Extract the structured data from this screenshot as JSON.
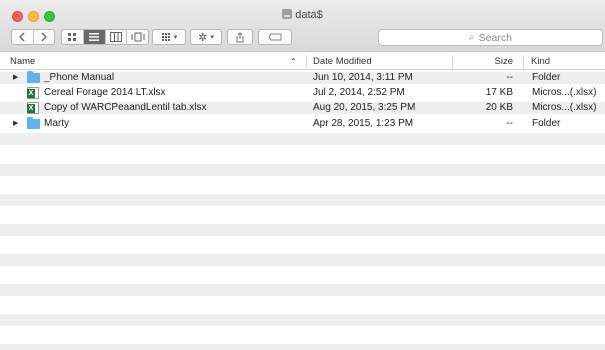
{
  "window": {
    "title": "data$"
  },
  "toolbar": {
    "back_icon": "chevron-left-icon",
    "forward_icon": "chevron-right-icon",
    "views": [
      "icon-view-icon",
      "list-view-icon",
      "column-view-icon",
      "cover-flow-icon"
    ],
    "arrange_icon": "grid-arrange-icon",
    "action_icon": "gear-icon",
    "share_icon": "share-icon",
    "tag_icon": "tag-icon"
  },
  "search": {
    "placeholder": "Search"
  },
  "columns": {
    "name": "Name",
    "date": "Date Modified",
    "size": "Size",
    "kind": "Kind"
  },
  "files": [
    {
      "name": "_Phone Manual",
      "date": "Jun 10, 2014, 3:11 PM",
      "size": "--",
      "kind": "Folder",
      "type": "folder"
    },
    {
      "name": "Cereal Forage 2014 LT.xlsx",
      "date": "Jul 2, 2014, 2:52 PM",
      "size": "17 KB",
      "kind": "Micros...(.xlsx)",
      "type": "xlsx"
    },
    {
      "name": "Copy of WARCPeaandLentil tab.xlsx",
      "date": "Aug 20, 2015, 3:25 PM",
      "size": "20 KB",
      "kind": "Micros...(.xlsx)",
      "type": "xlsx"
    },
    {
      "name": "Marty",
      "date": "Apr 28, 2015, 1:23 PM",
      "size": "--",
      "kind": "Folder",
      "type": "folder"
    }
  ]
}
